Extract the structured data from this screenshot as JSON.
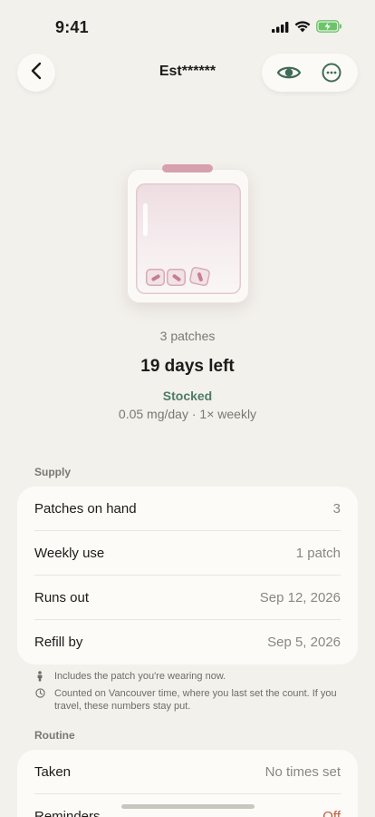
{
  "status_bar": {
    "time": "9:41"
  },
  "header": {
    "title": "Est******"
  },
  "summary": {
    "patch_count": "3 patches",
    "days_left": "19 days left",
    "status": "Stocked",
    "dose": "0.05 mg/day · 1× weekly"
  },
  "supply": {
    "section_label": "Supply",
    "rows": [
      {
        "label": "Patches on hand",
        "value": "3"
      },
      {
        "label": "Weekly use",
        "value": "1 patch"
      },
      {
        "label": "Runs out",
        "value": "Sep 12, 2026"
      },
      {
        "label": "Refill by",
        "value": "Sep 5, 2026"
      }
    ],
    "notes": [
      {
        "icon": "person-icon",
        "text": "Includes the patch you're wearing now."
      },
      {
        "icon": "clock-icon",
        "text": "Counted on Vancouver time, where you last set the count. If you travel, these numbers stay put."
      }
    ]
  },
  "routine": {
    "section_label": "Routine",
    "rows": [
      {
        "label": "Taken",
        "value": "No times set"
      },
      {
        "label": "Reminders",
        "value": "Off"
      }
    ]
  },
  "colors": {
    "background": "#f3f1ec",
    "card": "#fcfbf8",
    "accent_green": "#4e7c66",
    "accent_pink": "#d7a0ad",
    "off_red": "#c25a3c"
  }
}
